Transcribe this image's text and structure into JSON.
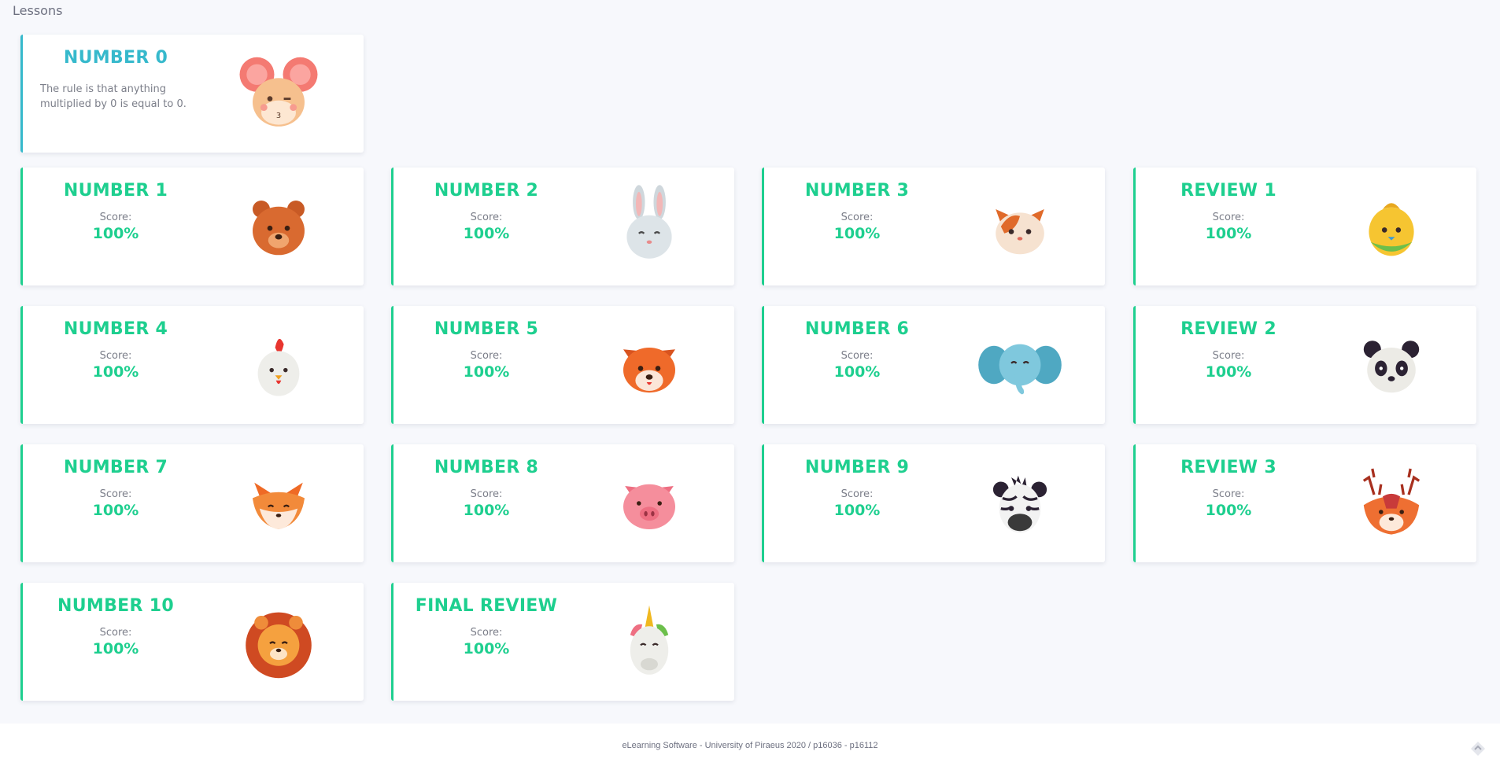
{
  "page": {
    "heading": "Lessons"
  },
  "lessons": [
    {
      "title": "NUMBER 0",
      "description": "The rule is that anything multiplied by 0 is equal to 0.",
      "animal": "mouse-icon",
      "status": "intro"
    },
    {
      "title": "NUMBER 1",
      "score_label": "Score:",
      "score": "100%",
      "animal": "bear-icon",
      "status": "done"
    },
    {
      "title": "NUMBER 2",
      "score_label": "Score:",
      "score": "100%",
      "animal": "rabbit-icon",
      "status": "done"
    },
    {
      "title": "NUMBER 3",
      "score_label": "Score:",
      "score": "100%",
      "animal": "cat-icon",
      "status": "done"
    },
    {
      "title": "REVIEW 1",
      "score_label": "Score:",
      "score": "100%",
      "animal": "bird-icon",
      "status": "done"
    },
    {
      "title": "NUMBER 4",
      "score_label": "Score:",
      "score": "100%",
      "animal": "chicken-icon",
      "status": "done"
    },
    {
      "title": "NUMBER 5",
      "score_label": "Score:",
      "score": "100%",
      "animal": "dog-icon",
      "status": "done"
    },
    {
      "title": "NUMBER 6",
      "score_label": "Score:",
      "score": "100%",
      "animal": "elephant-icon",
      "status": "done"
    },
    {
      "title": "REVIEW 2",
      "score_label": "Score:",
      "score": "100%",
      "animal": "panda-icon",
      "status": "done"
    },
    {
      "title": "NUMBER 7",
      "score_label": "Score:",
      "score": "100%",
      "animal": "fox-icon",
      "status": "done"
    },
    {
      "title": "NUMBER 8",
      "score_label": "Score:",
      "score": "100%",
      "animal": "pig-icon",
      "status": "done"
    },
    {
      "title": "NUMBER 9",
      "score_label": "Score:",
      "score": "100%",
      "animal": "zebra-icon",
      "status": "done"
    },
    {
      "title": "REVIEW 3",
      "score_label": "Score:",
      "score": "100%",
      "animal": "deer-icon",
      "status": "done"
    },
    {
      "title": "NUMBER 10",
      "score_label": "Score:",
      "score": "100%",
      "animal": "lion-icon",
      "status": "done"
    },
    {
      "title": "FINAL REVIEW",
      "score_label": "Score:",
      "score": "100%",
      "animal": "unicorn-icon",
      "status": "done"
    }
  ],
  "colors": {
    "done": "#1ecf8f",
    "intro": "#36b9cc",
    "background": "#f7f8fc"
  },
  "footer": {
    "text": "eLearning Software - University of Piraeus 2020 / p16036 - p16112",
    "scroll_icon": "scroll-to-top-icon"
  }
}
